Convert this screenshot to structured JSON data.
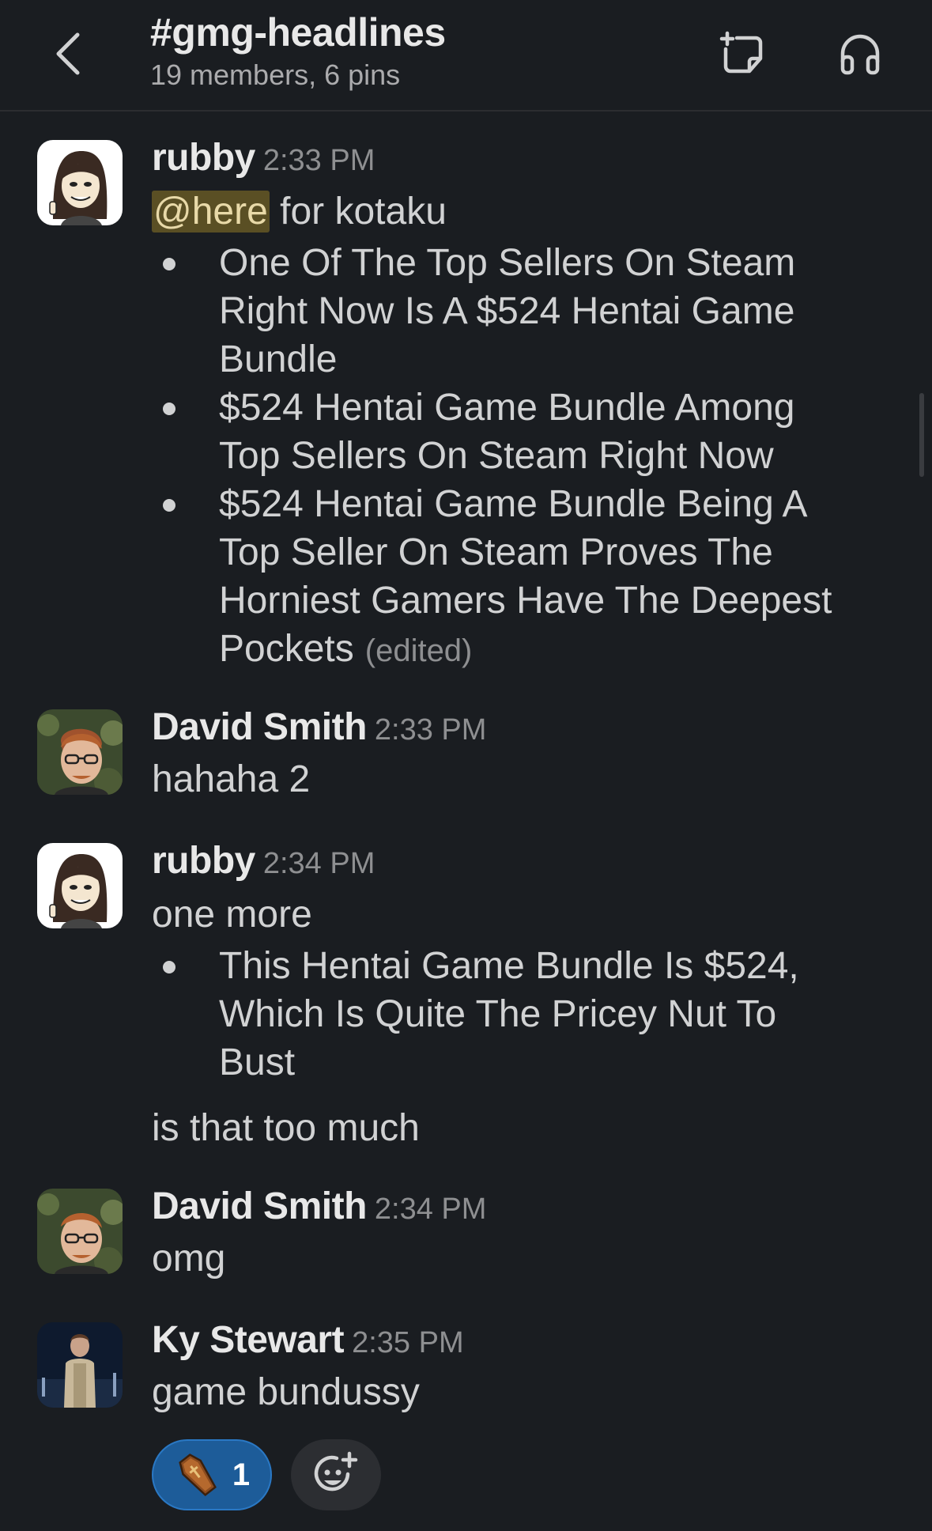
{
  "header": {
    "channel_name": "#gmg-headlines",
    "subtitle": "19 members, 6 pins",
    "icons": [
      "back-chevron-icon",
      "new-canvas-icon",
      "headphones-icon"
    ]
  },
  "messages": [
    {
      "author": "rubby",
      "time": "2:33 PM",
      "avatar": "cartoon-woman-avatar",
      "mention": "@here",
      "text_after_mention": " for kotaku",
      "bullets": [
        "One Of The Top Sellers On Steam Right Now Is A $524 Hentai Game Bundle",
        "$524 Hentai Game Bundle Among Top Sellers On Steam Right Now",
        "$524 Hentai Game Bundle Being A Top Seller On Steam Proves The Horniest Gamers Have The Deepest Pockets"
      ],
      "edited_label": "(edited)"
    },
    {
      "author": "David Smith",
      "time": "2:33 PM",
      "avatar": "photo-man-glasses-avatar",
      "text": "hahaha 2"
    },
    {
      "author": "rubby",
      "time": "2:34 PM",
      "avatar": "cartoon-woman-avatar",
      "text": "one more",
      "bullets": [
        "This Hentai Game Bundle Is $524, Which Is Quite The Pricey Nut To Bust"
      ],
      "text_after": "is that too much"
    },
    {
      "author": "David Smith",
      "time": "2:34 PM",
      "avatar": "photo-man-glasses-avatar",
      "text": "omg"
    },
    {
      "author": "Ky Stewart",
      "time": "2:35 PM",
      "avatar": "photo-man-standing-avatar",
      "text": "game bundussy",
      "reactions": [
        {
          "emoji": "coffin-emoji-icon",
          "count": "1"
        }
      ],
      "add_reaction_icon": "add-emoji-icon"
    }
  ],
  "colors": {
    "background": "#1a1d21",
    "text": "#d1d2d3",
    "muted": "#8e8f91",
    "mention_bg": "#5a4f24",
    "reaction_bg": "#1d5c99"
  }
}
